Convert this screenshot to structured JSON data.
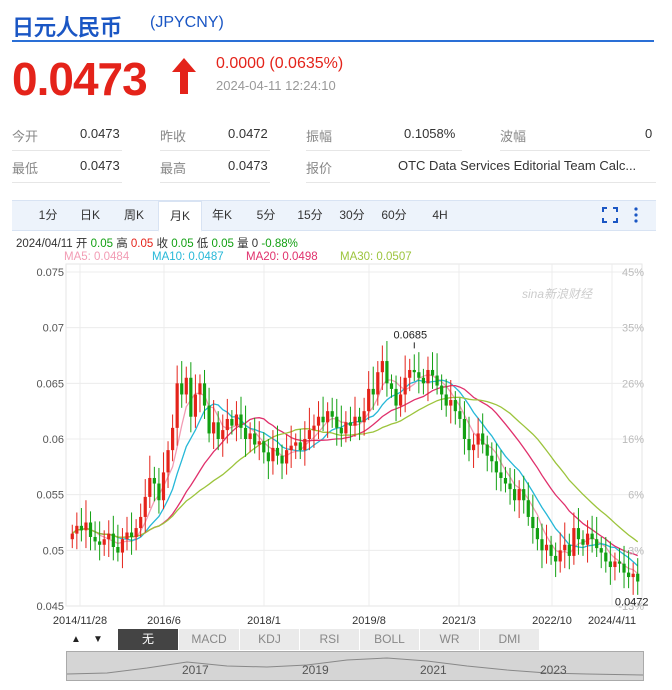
{
  "header": {
    "name": "日元人民币",
    "code": "(JPYCNY)"
  },
  "quote": {
    "price": "0.0473",
    "change": "0.0000 (0.0635%)",
    "time": "2024-04-11 12:24:10"
  },
  "stats": {
    "open_label": "今开",
    "open": "0.0473",
    "prev_label": "昨收",
    "prev": "0.0472",
    "amp_label": "振幅",
    "amp": "0.1058%",
    "vol_label": "波幅",
    "vol": "0",
    "low_label": "最低",
    "low": "0.0473",
    "high_label": "最高",
    "high": "0.0473",
    "src_label": "报价",
    "src": "OTC Data Services Editorial Team Calc..."
  },
  "periods": [
    "1分",
    "日K",
    "周K",
    "月K",
    "年K",
    "5分",
    "15分",
    "30分",
    "60分",
    "4H"
  ],
  "active_period": "月K",
  "bar_info": {
    "date": "2024/04/11",
    "open_label": "开",
    "open": "0.05",
    "high_label": "高",
    "high": "0.05",
    "close_label": "收",
    "close": "0.05",
    "low_label": "低",
    "low": "0.05",
    "vol_label": "量",
    "vol": "0",
    "pct": "-0.88%"
  },
  "ma_legend": [
    {
      "label": "MA5: 0.0484",
      "color": "#f29cb4"
    },
    {
      "label": "MA10: 0.0487",
      "color": "#26b8d8"
    },
    {
      "label": "MA20: 0.0498",
      "color": "#e0306c"
    },
    {
      "label": "MA30: 0.0507",
      "color": "#9cc43c"
    }
  ],
  "watermark": "sina新浪财经",
  "indicators": [
    "无",
    "MACD",
    "KDJ",
    "RSI",
    "BOLL",
    "WR",
    "DMI"
  ],
  "nav_years": [
    "2017",
    "2019",
    "2021",
    "2023"
  ],
  "colors": {
    "up": "#e4231a",
    "down": "#12a012",
    "accent": "#1a56c4"
  },
  "chart_data": {
    "type": "candlestick",
    "ylim": [
      0.045,
      0.075
    ],
    "y_ticks": [
      "0.075",
      "0.07",
      "0.065",
      "0.06",
      "0.055",
      "0.05",
      "0.045"
    ],
    "pct_ticks": [
      "45%",
      "35%",
      "26%",
      "16%",
      "6%",
      "-3%",
      "-13%"
    ],
    "x_ticks": [
      "2014/11/28",
      "2016/6",
      "2018/1",
      "2019/8",
      "2021/3",
      "2022/10",
      "2024/4/11"
    ],
    "period_start": "2014-11",
    "period_end": "2024-04",
    "annotations": [
      {
        "text": "0.0685"
      },
      {
        "text": "0.0472"
      }
    ],
    "close": [
      0.0515,
      0.0522,
      0.0518,
      0.0525,
      0.0512,
      0.0508,
      0.0505,
      0.051,
      0.0515,
      0.0503,
      0.0498,
      0.051,
      0.0516,
      0.0512,
      0.052,
      0.053,
      0.0548,
      0.0565,
      0.056,
      0.0545,
      0.057,
      0.059,
      0.061,
      0.065,
      0.064,
      0.0655,
      0.062,
      0.064,
      0.065,
      0.063,
      0.0605,
      0.0615,
      0.06,
      0.0608,
      0.0618,
      0.0612,
      0.0622,
      0.061,
      0.06,
      0.0605,
      0.0595,
      0.0598,
      0.0588,
      0.058,
      0.0592,
      0.0585,
      0.0578,
      0.059,
      0.0594,
      0.0597,
      0.059,
      0.06,
      0.0608,
      0.0612,
      0.062,
      0.0615,
      0.0625,
      0.062,
      0.061,
      0.0605,
      0.0615,
      0.0612,
      0.062,
      0.0615,
      0.0625,
      0.0645,
      0.064,
      0.066,
      0.067,
      0.065,
      0.0645,
      0.063,
      0.064,
      0.0655,
      0.0662,
      0.066,
      0.0655,
      0.065,
      0.0662,
      0.0657,
      0.0648,
      0.064,
      0.063,
      0.0635,
      0.0625,
      0.0618,
      0.06,
      0.059,
      0.0595,
      0.0605,
      0.0595,
      0.0585,
      0.058,
      0.057,
      0.0565,
      0.056,
      0.0555,
      0.0545,
      0.0555,
      0.0545,
      0.053,
      0.052,
      0.051,
      0.05,
      0.0505,
      0.0495,
      0.049,
      0.05,
      0.0505,
      0.0495,
      0.052,
      0.051,
      0.0505,
      0.0515,
      0.051,
      0.0502,
      0.0498,
      0.049,
      0.0485,
      0.049,
      0.0488,
      0.048,
      0.0476,
      0.0479,
      0.0472
    ]
  }
}
